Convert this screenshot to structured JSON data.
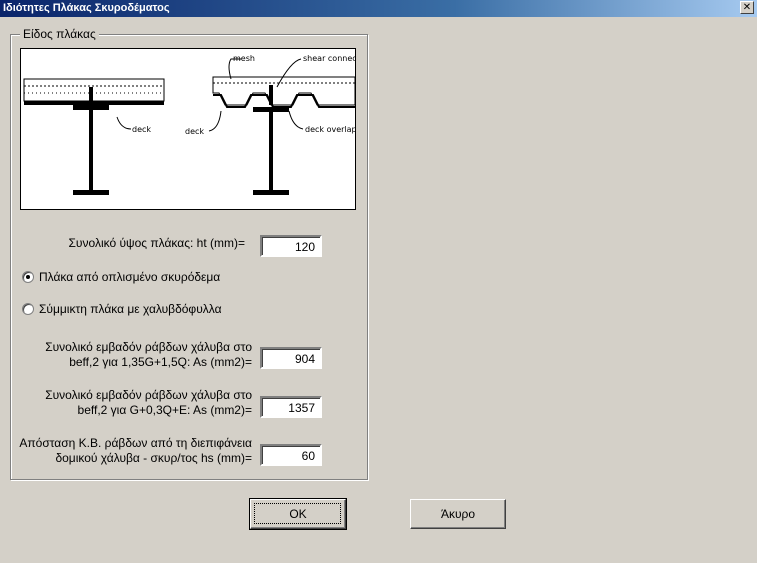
{
  "window": {
    "title": "Ιδιότητες Πλάκας Σκυροδέματος",
    "close_glyph": "✕"
  },
  "group": {
    "legend": "Είδος πλάκας",
    "diagram_labels": {
      "deck_left": "deck",
      "mesh": "mesh",
      "shear": "shear connector",
      "deck_right": "deck",
      "overlap": "deck overlap"
    }
  },
  "fields": {
    "ht": {
      "label": "Συνολικό ύψος πλάκας: ht (mm)=",
      "value": "120"
    },
    "as1": {
      "label_line1": "Συνολικό εμβαδόν ράβδων χάλυβα στο",
      "label_line2": "beff,2 για 1,35G+1,5Q: As (mm2)=",
      "value": "904"
    },
    "as2": {
      "label_line1": "Συνολικό εμβαδόν ράβδων χάλυβα στο",
      "label_line2": "beff,2 για G+0,3Q+E: As (mm2)=",
      "value": "1357"
    },
    "hs": {
      "label_line1": "Απόσταση Κ.Β. ράβδων από τη διεπιφάνεια",
      "label_line2": "δομικού χάλυβα - σκυρ/τος hs (mm)=",
      "value": "60"
    }
  },
  "radios": [
    {
      "label": "Πλάκα από οπλισμένο σκυρόδεμα",
      "checked": true
    },
    {
      "label": "Σύμμικτη πλάκα με χαλυβδόφυλλα",
      "checked": false
    }
  ],
  "buttons": {
    "ok": "OK",
    "cancel": "Άκυρο"
  }
}
